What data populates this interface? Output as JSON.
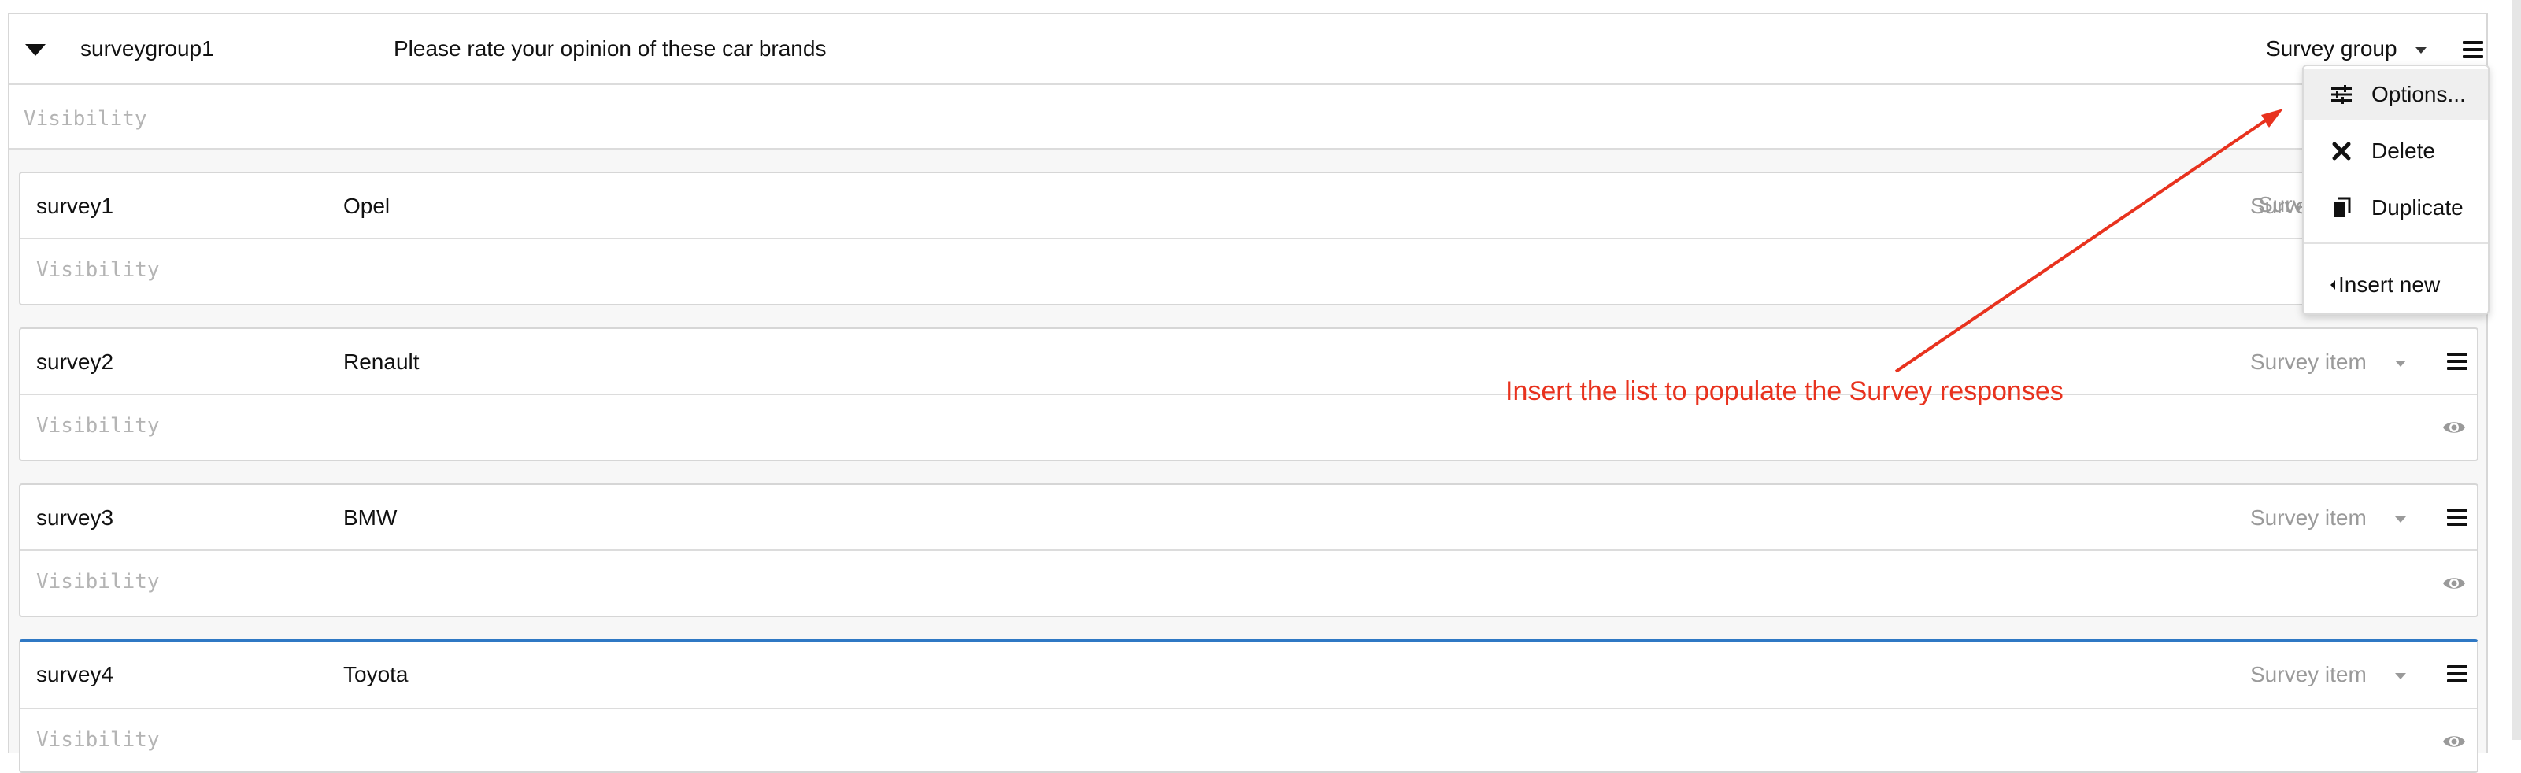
{
  "group": {
    "name": "surveygroup1",
    "title": "Please rate your opinion of these car brands",
    "type": "Survey group",
    "visibility": "Visibility"
  },
  "items": [
    {
      "name": "survey1",
      "title": "Opel",
      "type": "Survey item",
      "visibility": "Visibility"
    },
    {
      "name": "survey2",
      "title": "Renault",
      "type": "Survey item",
      "visibility": "Visibility"
    },
    {
      "name": "survey3",
      "title": "BMW",
      "type": "Survey item",
      "visibility": "Visibility"
    },
    {
      "name": "survey4",
      "title": "Toyota",
      "type": "Survey item",
      "visibility": "Visibility"
    }
  ],
  "menu": {
    "options": "Options...",
    "delete": "Delete",
    "duplicate": "Duplicate",
    "insert_new": "Insert new"
  },
  "annotation": {
    "text": "Insert the list to populate the Survey responses",
    "color": "#e8321e"
  },
  "colors": {
    "accent": "#2f78c4",
    "muted": "#9a9a9a",
    "border": "#d6d6d6"
  }
}
